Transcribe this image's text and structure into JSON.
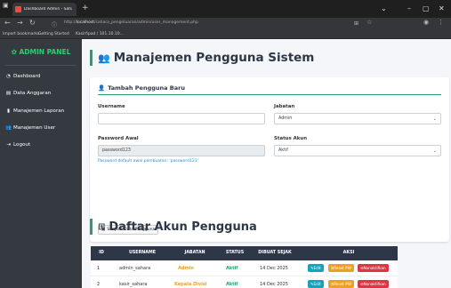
{
  "browser": {
    "tab_title": "Dashboard Admin - Sahara ×",
    "url_host": "localhost",
    "url_prefix": "http://",
    "url_rest": "/sahara_pengeluaran/admin/user_management.php",
    "bookmarks": [
      "Import bookmarks...",
      "Getting Started",
      "Kasirñpad / 101.10.10..."
    ]
  },
  "sidebar": {
    "brand": "ADMIN PANEL",
    "items": [
      {
        "label": "Dashboard",
        "icon": "gauge-icon"
      },
      {
        "label": "Data Anggaran",
        "icon": "file-icon"
      },
      {
        "label": "Manajemen Laporan",
        "icon": "report-icon"
      },
      {
        "label": "Manajemen User",
        "icon": "users-icon"
      },
      {
        "label": "Logout",
        "icon": "logout-icon"
      }
    ]
  },
  "page": {
    "title": "Manajemen Pengguna Sistem"
  },
  "form": {
    "heading": "Tambah Pengguna Baru",
    "username_label": "Username",
    "username_value": "",
    "jabatan_label": "Jabatan",
    "jabatan_value": "Admin",
    "password_label": "Password Awal",
    "password_value": "password123",
    "status_label": "Status Akun",
    "status_value": "Aktif",
    "hint": "Password default awal pembuatan: 'password123'",
    "save_label": "Simpan Data Pengguna"
  },
  "table": {
    "title": "Daftar Akun Pengguna",
    "columns": [
      "ID",
      "USERNAME",
      "JABATAN",
      "STATUS",
      "DIBUAT SEJAK",
      "AKSI"
    ],
    "rows": [
      {
        "id": "1",
        "username": "admin_sahara",
        "jabatan": "Admin",
        "status": "Aktif",
        "created": "14 Dec 2025",
        "actions": [
          "Edit",
          "Reset PW",
          "Nonaktifkan"
        ]
      },
      {
        "id": "2",
        "username": "kasir_sahara",
        "jabatan": "Kepala Divisi",
        "status": "Aktif",
        "created": "14 Dec 2025",
        "actions": [
          "Edit",
          "Reset PW",
          "Nonaktifkan"
        ]
      }
    ]
  },
  "colors": {
    "accent": "#2a9d6a",
    "sidebar": "#343a40",
    "table_head": "#2d3748"
  }
}
